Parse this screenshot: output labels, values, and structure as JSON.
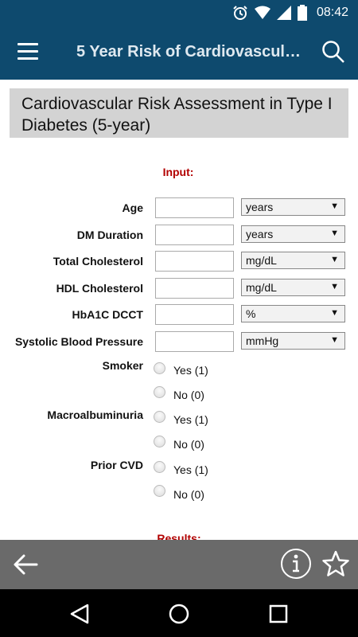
{
  "status_bar": {
    "time": "08:42",
    "icons": [
      "alarm-icon",
      "wifi-icon",
      "signal-icon",
      "battery-icon"
    ]
  },
  "app_bar": {
    "title": "5 Year Risk of Cardiovascul…",
    "icons": [
      "menu-icon",
      "search-icon"
    ]
  },
  "header": {
    "title": "Cardiovascular Risk Assessment in Type I Diabetes (5-year)"
  },
  "input_heading": "Input:",
  "fields": [
    {
      "label": "Age",
      "value": "",
      "unit": "years"
    },
    {
      "label": "DM Duration",
      "value": "",
      "unit": "years"
    },
    {
      "label": "Total Cholesterol",
      "value": "",
      "unit": "mg/dL"
    },
    {
      "label": "HDL Cholesterol",
      "value": "",
      "unit": "mg/dL"
    },
    {
      "label": "HbA1C DCCT",
      "value": "",
      "unit": "%"
    },
    {
      "label": "Systolic Blood Pressure",
      "value": "",
      "unit": "mmHg"
    }
  ],
  "radio_groups": [
    {
      "label": "Smoker",
      "options": [
        "Yes (1)",
        "No (0)"
      ]
    },
    {
      "label": "Macroalbuminuria",
      "options": [
        "Yes (1)",
        "No (0)"
      ]
    },
    {
      "label": "Prior CVD",
      "options": [
        "Yes (1)",
        "No (0)"
      ]
    }
  ],
  "results_heading": "Results:",
  "toolbar": {
    "icons": [
      "back-arrow-icon",
      "info-icon",
      "star-icon"
    ]
  },
  "nav": {
    "icons": [
      "nav-back-icon",
      "nav-home-icon",
      "nav-recent-icon"
    ]
  },
  "colors": {
    "app_bar": "#0e4a6e",
    "heading_red": "#b20000",
    "toolbar": "#6a6a6a",
    "header_box": "#d3d3d3"
  }
}
